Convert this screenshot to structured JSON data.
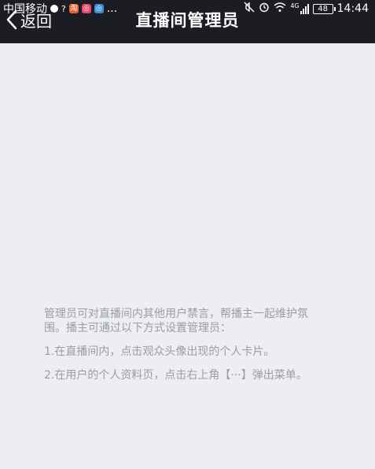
{
  "status_bar": {
    "carrier": "中国移动",
    "more": "...",
    "network": "4G",
    "battery": "48",
    "time": "14:44"
  },
  "nav": {
    "back_label": "返回",
    "title": "直播间管理员"
  },
  "content": {
    "intro": "管理员可对直播间内其他用户禁言，帮播主一起维护氛围。播主可通过以下方式设置管理员：",
    "method_1": "1.在直播间内，点击观众头像出现的个人卡片。",
    "method_2": "2.在用户的个人资料页，点击右上角【···】弹出菜单。"
  },
  "colors": {
    "topbar": "#1b1d22",
    "background": "#eceef2",
    "text_secondary": "#9a9da3"
  }
}
